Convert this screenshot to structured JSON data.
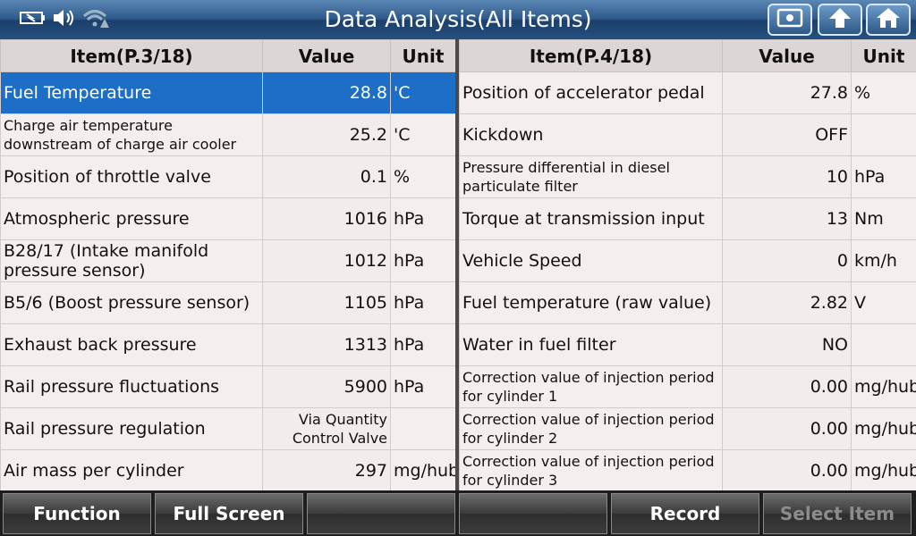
{
  "header": {
    "title": "Data Analysis(All Items)",
    "icons": [
      "battery-icon",
      "volume-icon",
      "wifi-warning-icon"
    ],
    "buttons": [
      "screenshot-icon",
      "back-icon",
      "home-icon"
    ]
  },
  "left": {
    "headers": {
      "item": "Item(P.3/18)",
      "value": "Value",
      "unit": "Unit"
    },
    "rows": [
      {
        "name": "Fuel Temperature",
        "value": "28.8",
        "unit": "'C",
        "selected": true
      },
      {
        "name": "Charge air temperature downstream of charge air cooler",
        "value": "25.2",
        "unit": "'C"
      },
      {
        "name": "Position of throttle valve",
        "value": "0.1",
        "unit": "%"
      },
      {
        "name": "Atmospheric pressure",
        "value": "1016",
        "unit": "hPa"
      },
      {
        "name": "B28/17 (Intake manifold pressure sensor)",
        "value": "1012",
        "unit": "hPa"
      },
      {
        "name": "B5/6 (Boost pressure sensor)",
        "value": "1105",
        "unit": "hPa"
      },
      {
        "name": "Exhaust back pressure",
        "value": "1313",
        "unit": "hPa"
      },
      {
        "name": "Rail pressure fluctuations",
        "value": "5900",
        "unit": "hPa"
      },
      {
        "name": "Rail pressure regulation",
        "value": "Via Quantity Control Valve",
        "unit": ""
      },
      {
        "name": "Air mass per cylinder",
        "value": "297",
        "unit": "mg/hub"
      }
    ]
  },
  "right": {
    "headers": {
      "item": "Item(P.4/18)",
      "value": "Value",
      "unit": "Unit"
    },
    "rows": [
      {
        "name": "Position of accelerator pedal",
        "value": "27.8",
        "unit": "%"
      },
      {
        "name": "Kickdown",
        "value": "OFF",
        "unit": ""
      },
      {
        "name": "Pressure differential in diesel particulate filter",
        "value": "10",
        "unit": "hPa"
      },
      {
        "name": "Torque at transmission input",
        "value": "13",
        "unit": "Nm"
      },
      {
        "name": "Vehicle Speed",
        "value": "0",
        "unit": "km/h"
      },
      {
        "name": "Fuel temperature (raw value)",
        "value": "2.82",
        "unit": "V"
      },
      {
        "name": "Water in fuel filter",
        "value": "NO",
        "unit": ""
      },
      {
        "name": "Correction value of injection period for cylinder 1",
        "value": "0.00",
        "unit": "mg/hub"
      },
      {
        "name": "Correction value of injection period for cylinder 2",
        "value": "0.00",
        "unit": "mg/hub"
      },
      {
        "name": "Correction value of injection period for cylinder 3",
        "value": "0.00",
        "unit": "mg/hub"
      }
    ]
  },
  "footer": {
    "buttons": [
      {
        "label": "Function",
        "enabled": true
      },
      {
        "label": "Full Screen",
        "enabled": true
      },
      {
        "label": "",
        "enabled": true
      },
      {
        "label": "",
        "enabled": true
      },
      {
        "label": "Record",
        "enabled": true
      },
      {
        "label": "Select Item",
        "enabled": false
      }
    ]
  },
  "colors": {
    "selected_row": "#1c6ec6",
    "header_bar": "#2f5b8c"
  }
}
